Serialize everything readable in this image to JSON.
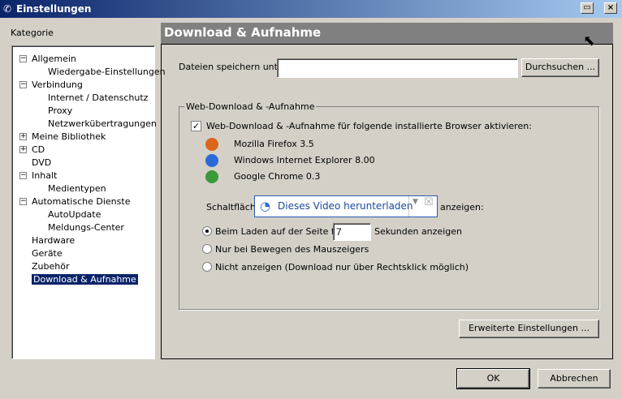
{
  "window": {
    "title": "Einstellungen"
  },
  "sidebar": {
    "label": "Kategorie",
    "items": [
      {
        "label": "Allgemein",
        "level": 0,
        "expander": "−"
      },
      {
        "label": "Wiedergabe-Einstellungen",
        "level": 1
      },
      {
        "label": "Verbindung",
        "level": 0,
        "expander": "−"
      },
      {
        "label": "Internet / Datenschutz",
        "level": 1
      },
      {
        "label": "Proxy",
        "level": 1
      },
      {
        "label": "Netzwerkübertragungen",
        "level": 1
      },
      {
        "label": "Meine Bibliothek",
        "level": 0,
        "expander": "+"
      },
      {
        "label": "CD",
        "level": 0,
        "expander": "+"
      },
      {
        "label": "DVD",
        "level": 0
      },
      {
        "label": "Inhalt",
        "level": 0,
        "expander": "−"
      },
      {
        "label": "Medientypen",
        "level": 1
      },
      {
        "label": "Automatische Dienste",
        "level": 0,
        "expander": "−"
      },
      {
        "label": "AutoUpdate",
        "level": 1
      },
      {
        "label": "Meldungs-Center",
        "level": 1
      },
      {
        "label": "Hardware",
        "level": 0
      },
      {
        "label": "Geräte",
        "level": 0
      },
      {
        "label": "Zubehör",
        "level": 0
      },
      {
        "label": "Download & Aufnahme",
        "level": 0,
        "selected": true
      }
    ]
  },
  "main": {
    "title": "Download & Aufnahme",
    "save_label": "Dateien speichern unter:",
    "save_value": "",
    "browse_label": "Durchsuchen ...",
    "group_label": "Web-Download & -Aufnahme",
    "enable_label": "Web-Download & -Aufnahme für folgende installierte Browser aktivieren:",
    "enable_checked": true,
    "browsers": [
      {
        "name": "Mozilla Firefox 3.5",
        "icon": "firefox-icon",
        "color": "#d9661a"
      },
      {
        "name": "Windows Internet Explorer 8.00",
        "icon": "ie-icon",
        "color": "#2a6ad8"
      },
      {
        "name": "Google Chrome 0.3",
        "icon": "chrome-icon",
        "color": "#3a9a3a"
      }
    ],
    "button_prefix": "Schaltfläche",
    "button_preview": "Dieses Video herunterladen",
    "button_suffix": "anzeigen:",
    "radio1_pre": "Beim Laden auf der Seite für",
    "radio1_value": "7",
    "radio1_post": "Sekunden anzeigen",
    "radio2": "Nur bei Bewegen des Mauszeigers",
    "radio3": "Nicht anzeigen (Download nur über Rechtsklick möglich)",
    "advanced_label": "Erweiterte Einstellungen ..."
  },
  "footer": {
    "ok": "OK",
    "cancel": "Abbrechen"
  }
}
